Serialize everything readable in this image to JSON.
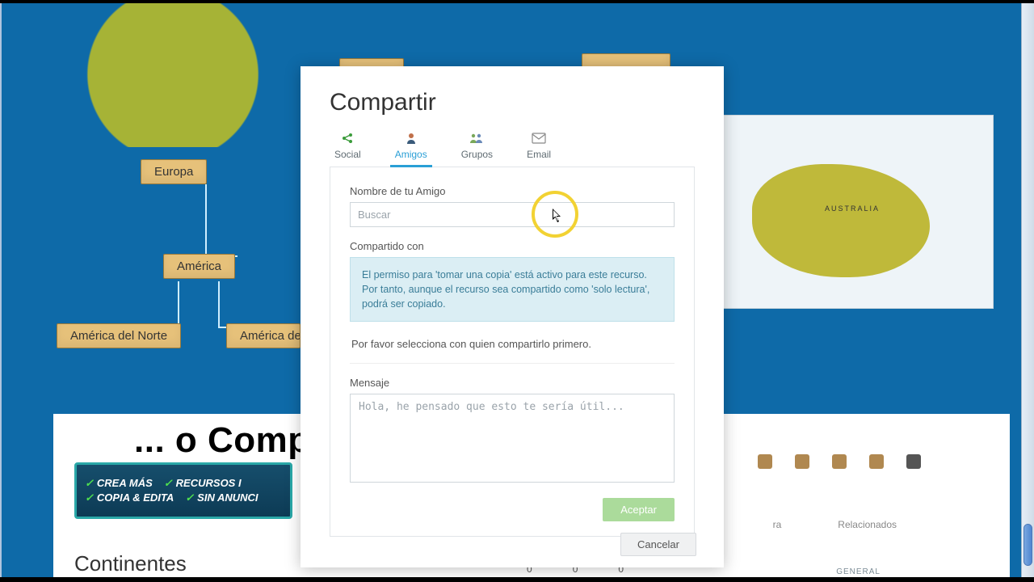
{
  "background": {
    "nodes": {
      "europa": "Europa",
      "america": "América",
      "america_norte": "América del Norte",
      "america_sur_truncated": "América de",
      "australia_label": "AUSTRALIA"
    },
    "info_bar": {
      "item1": "CREA MÁS",
      "item2": "RECURSOS I",
      "item3": "COPIA & EDITA",
      "item4": "SIN ANUNCI"
    },
    "page_title_lower": "Continentes",
    "side_labels": {
      "a": "ra",
      "b": "Relacionados"
    },
    "general_label": "GENERAL",
    "dots": [
      "0",
      "0",
      "0"
    ]
  },
  "caption": "... o Compartirlo con tus Amigos",
  "modal": {
    "title": "Compartir",
    "tabs": {
      "social": "Social",
      "amigos": "Amigos",
      "grupos": "Grupos",
      "email": "Email"
    },
    "friend_name_label": "Nombre de tu Amigo",
    "friend_name_placeholder": "Buscar",
    "shared_with_label": "Compartido con",
    "info_text": "El permiso para 'tomar una copia' está activo para este recurso. Por tanto, aunque el recurso sea compartido como 'solo lectura', podrá ser copiado.",
    "select_first_text": "Por favor selecciona con quien compartirlo primero.",
    "message_label": "Mensaje",
    "message_placeholder": "Hola, he pensado que esto te sería útil...",
    "accept": "Aceptar",
    "cancel": "Cancelar"
  }
}
